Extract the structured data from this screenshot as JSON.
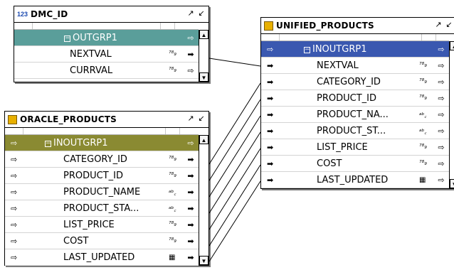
{
  "dmc": {
    "title": "DMC_ID",
    "icon_label": "123",
    "group": "OUTGRP1",
    "rows": [
      {
        "name": "NEXTVAL",
        "type": "789"
      },
      {
        "name": "CURRVAL",
        "type": "789"
      }
    ]
  },
  "oracle": {
    "title": "ORACLE_PRODUCTS",
    "group": "INOUTGRP1",
    "rows": [
      {
        "name": "CATEGORY_ID",
        "type": "789"
      },
      {
        "name": "PRODUCT_ID",
        "type": "789"
      },
      {
        "name": "PRODUCT_NAME",
        "type": "abc"
      },
      {
        "name": "PRODUCT_STA...",
        "type": "abc"
      },
      {
        "name": "LIST_PRICE",
        "type": "789"
      },
      {
        "name": "COST",
        "type": "789"
      },
      {
        "name": "LAST_UPDATED",
        "type": "date"
      }
    ]
  },
  "unified": {
    "title": "UNIFIED_PRODUCTS",
    "group": "INOUTGRP1",
    "rows": [
      {
        "name": "NEXTVAL",
        "type": "789"
      },
      {
        "name": "CATEGORY_ID",
        "type": "789"
      },
      {
        "name": "PRODUCT_ID",
        "type": "789"
      },
      {
        "name": "PRODUCT_NA...",
        "type": "abc"
      },
      {
        "name": "PRODUCT_ST...",
        "type": "abc"
      },
      {
        "name": "LIST_PRICE",
        "type": "789"
      },
      {
        "name": "COST",
        "type": "789"
      },
      {
        "name": "LAST_UPDATED",
        "type": "date"
      }
    ]
  },
  "colors": {
    "dmc_group": "#5a9e9a",
    "oracle_group": "#8a8a32",
    "unified_group": "#3a58b0",
    "table_icon": "#e8b000"
  },
  "icons": {
    "maximize": "maximize-icon",
    "minimize": "minimize-icon",
    "arrow_out": "arrow-hollow-icon",
    "arrow_in": "arrow-filled-icon"
  }
}
